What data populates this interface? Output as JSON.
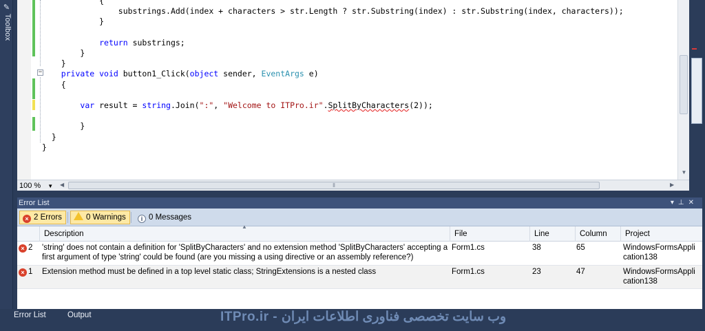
{
  "toolbox": {
    "label": "Toolbox"
  },
  "editor": {
    "lines": [
      {
        "indent": "            ",
        "segs": [
          {
            "t": "{"
          }
        ]
      },
      {
        "indent": "                ",
        "segs": [
          {
            "t": "substrings.Add(index + characters > str.Length ? str.Substring(index) : str.Substring(index, characters));"
          }
        ]
      },
      {
        "indent": "            ",
        "segs": [
          {
            "t": "}"
          }
        ]
      },
      {
        "indent": "",
        "segs": [
          {
            "t": ""
          }
        ]
      },
      {
        "indent": "            ",
        "segs": [
          {
            "t": "return",
            "c": "kw"
          },
          {
            "t": " substrings;"
          }
        ]
      },
      {
        "indent": "        ",
        "segs": [
          {
            "t": "}"
          }
        ]
      },
      {
        "indent": "    ",
        "segs": [
          {
            "t": "}"
          }
        ]
      },
      {
        "indent": "    ",
        "segs": [
          {
            "t": "private",
            "c": "kw"
          },
          {
            "t": " "
          },
          {
            "t": "void",
            "c": "kw"
          },
          {
            "t": " button1_Click("
          },
          {
            "t": "object",
            "c": "kw"
          },
          {
            "t": " sender, "
          },
          {
            "t": "EventArgs",
            "c": "ty"
          },
          {
            "t": " e)"
          }
        ]
      },
      {
        "indent": "    ",
        "segs": [
          {
            "t": "{"
          }
        ]
      },
      {
        "indent": "",
        "segs": [
          {
            "t": ""
          }
        ]
      },
      {
        "indent": "        ",
        "segs": [
          {
            "t": "var",
            "c": "kw"
          },
          {
            "t": " result = "
          },
          {
            "t": "string",
            "c": "kw"
          },
          {
            "t": ".Join("
          },
          {
            "t": "\":\"",
            "c": "st"
          },
          {
            "t": ", "
          },
          {
            "t": "\"Welcome to ITPro.ir\"",
            "c": "st"
          },
          {
            "t": "."
          },
          {
            "t": "SplitByCharacters",
            "c": "squig"
          },
          {
            "t": "(2));"
          }
        ]
      },
      {
        "indent": "",
        "segs": [
          {
            "t": ""
          }
        ]
      },
      {
        "indent": "        ",
        "segs": [
          {
            "t": "}"
          }
        ]
      },
      {
        "indent": "  ",
        "segs": [
          {
            "t": "}"
          }
        ]
      },
      {
        "indent": "",
        "segs": [
          {
            "t": "}"
          }
        ]
      }
    ]
  },
  "zoom": {
    "value": "100 %"
  },
  "error_list": {
    "title": "Error List",
    "filters": {
      "errors": "2 Errors",
      "warnings": "0 Warnings",
      "messages": "0 Messages"
    },
    "columns": {
      "description": "Description",
      "file": "File",
      "line": "Line",
      "column": "Column",
      "project": "Project"
    },
    "rows": [
      {
        "num": "2",
        "desc1": "'string' does not contain a definition for 'SplitByCharacters' and no extension method 'SplitByCharacters' accepting a",
        "desc2": "first argument of type 'string' could be found (are you missing a using directive or an assembly reference?)",
        "file": "Form1.cs",
        "line": "38",
        "column": "65",
        "project1": "WindowsFormsAppli",
        "project2": "cation138"
      },
      {
        "num": "1",
        "desc1": "Extension method must be defined in a top level static class; StringExtensions is a nested class",
        "desc2": "",
        "file": "Form1.cs",
        "line": "23",
        "column": "47",
        "project1": "WindowsFormsAppli",
        "project2": "cation138"
      }
    ]
  },
  "bottom": {
    "tab_errors": "Error List",
    "tab_output": "Output",
    "watermark": "ITPro.ir - وب سایت تخصصی فناوری اطلاعات ایران"
  }
}
